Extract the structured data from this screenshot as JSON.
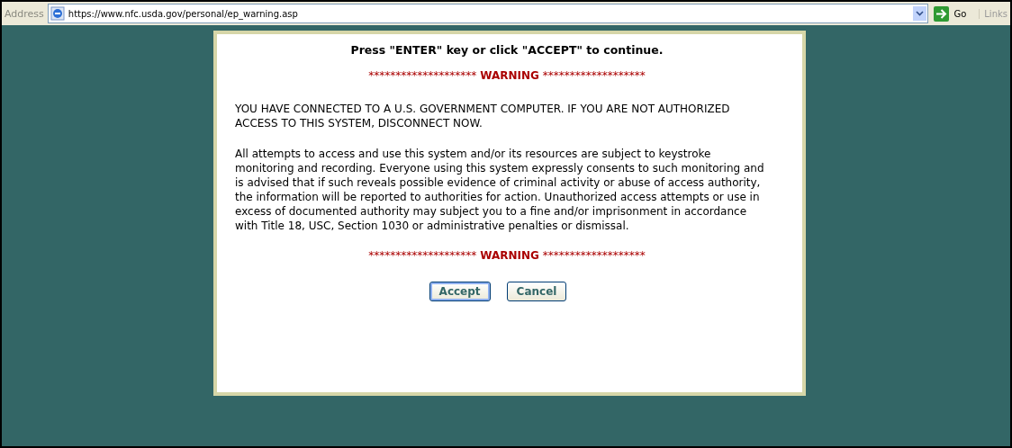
{
  "address_bar": {
    "label": "Address",
    "url": "https://www.nfc.usda.gov/personal/ep_warning.asp",
    "go": "Go",
    "links": "Links"
  },
  "dialog": {
    "instruction": "Press \"ENTER\" key or click \"ACCEPT\" to continue.",
    "warning_lines": [
      {
        "left": "********************",
        "word": "WARNING",
        "right": "*******************"
      },
      {
        "left": "********************",
        "word": "WARNING",
        "right": "*******************"
      }
    ],
    "paragraphs": [
      "YOU HAVE CONNECTED TO A U.S. GOVERNMENT COMPUTER. IF YOU ARE NOT AUTHORIZED ACCESS TO THIS SYSTEM, DISCONNECT NOW.",
      "All attempts to access and use this system and/or its resources are subject to keystroke monitoring and recording. Everyone using this system expressly consents to such monitoring and is advised that if such reveals possible evidence of criminal activity or abuse of access authority, the information will be reported to authorities for action. Unauthorized access attempts or use in excess of documented authority may subject you to a fine and/or imprisonment in accordance with Title 18, USC, Section 1030 or administrative penalties or dismissal."
    ],
    "buttons": [
      {
        "label": "Accept",
        "focused": true
      },
      {
        "label": "Cancel",
        "focused": false
      }
    ]
  }
}
